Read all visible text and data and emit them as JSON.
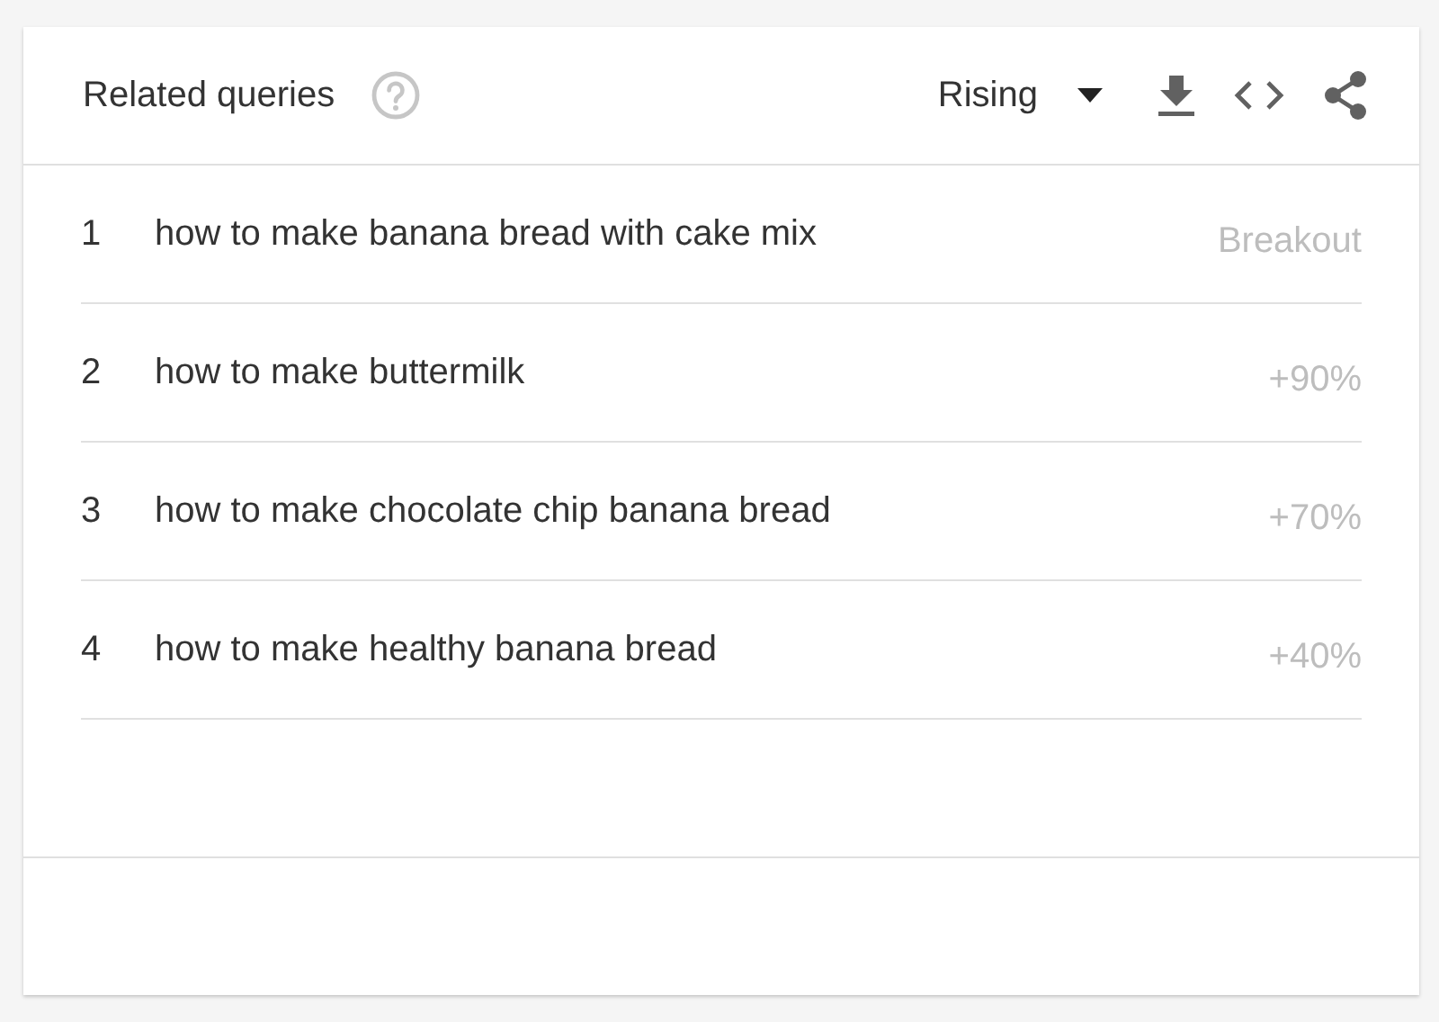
{
  "card": {
    "title": "Related queries",
    "filter": "Rising"
  },
  "rows": [
    {
      "rank": "1",
      "query": "how to make banana bread with cake mix",
      "value": "Breakout"
    },
    {
      "rank": "2",
      "query": "how to make buttermilk",
      "value": "+90%"
    },
    {
      "rank": "3",
      "query": "how to make chocolate chip banana bread",
      "value": "+70%"
    },
    {
      "rank": "4",
      "query": "how to make healthy banana bread",
      "value": "+40%"
    }
  ]
}
